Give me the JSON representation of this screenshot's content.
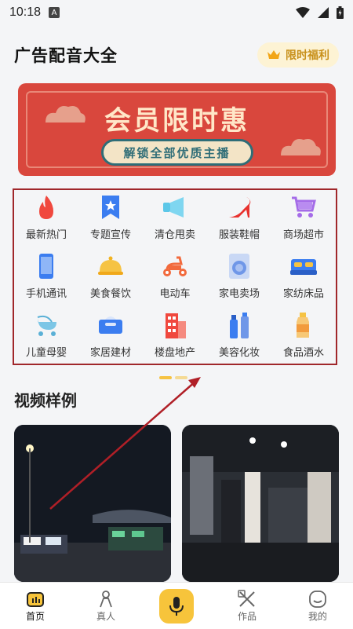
{
  "status": {
    "time": "10:18",
    "notif_letter": "A"
  },
  "header": {
    "title": "广告配音大全",
    "promo_label": "限时福利"
  },
  "banner": {
    "headline": "会员限时惠",
    "subtitle": "解锁全部优质主播"
  },
  "categories": [
    {
      "label": "最新热门",
      "icon": "flame-icon"
    },
    {
      "label": "专题宣传",
      "icon": "bookmark-star-icon"
    },
    {
      "label": "清仓甩卖",
      "icon": "megaphone-icon"
    },
    {
      "label": "服装鞋帽",
      "icon": "high-heel-icon"
    },
    {
      "label": "商场超市",
      "icon": "shopping-cart-icon"
    },
    {
      "label": "手机通讯",
      "icon": "phone-icon"
    },
    {
      "label": "美食餐饮",
      "icon": "food-cloche-icon"
    },
    {
      "label": "电动车",
      "icon": "scooter-icon"
    },
    {
      "label": "家电卖场",
      "icon": "washing-machine-icon"
    },
    {
      "label": "家纺床品",
      "icon": "bed-icon"
    },
    {
      "label": "儿童母婴",
      "icon": "stroller-icon"
    },
    {
      "label": "家居建材",
      "icon": "tissue-box-icon"
    },
    {
      "label": "楼盘地产",
      "icon": "building-icon"
    },
    {
      "label": "美容化妆",
      "icon": "cosmetics-icon"
    },
    {
      "label": "食品酒水",
      "icon": "bottle-icon"
    }
  ],
  "section": {
    "title": "视频样例"
  },
  "tabbar": {
    "items": [
      {
        "label": "首页",
        "icon": "home-icon"
      },
      {
        "label": "真人",
        "icon": "person-icon"
      },
      {
        "label": "",
        "icon": "mic-icon"
      },
      {
        "label": "作品",
        "icon": "works-icon"
      },
      {
        "label": "我的",
        "icon": "profile-icon"
      }
    ]
  },
  "colors": {
    "accent": "#f7c43b",
    "banner": "#d9473d",
    "highlight_frame": "#a0272b"
  }
}
